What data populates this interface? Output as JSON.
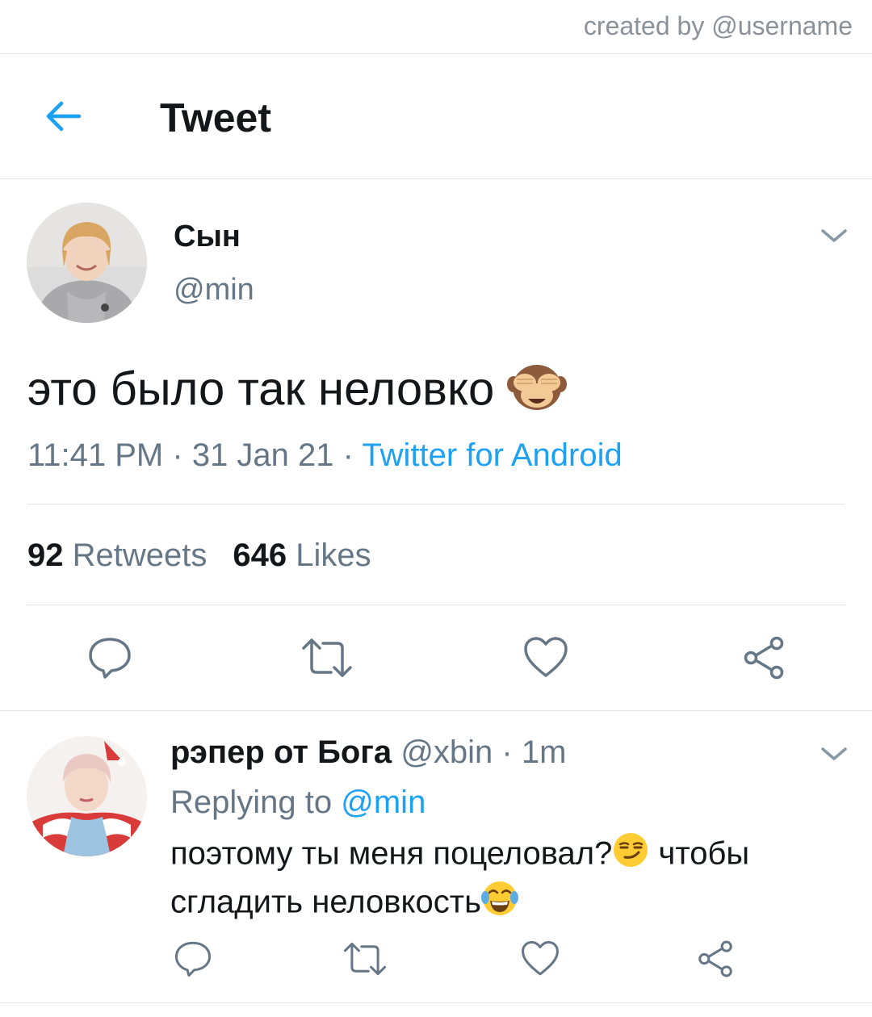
{
  "credit": "created by @username",
  "header": {
    "title": "Tweet"
  },
  "tweet": {
    "author_name": "Сын",
    "author_handle": "@min",
    "text": "это было так неловко",
    "time": "11:41 PM",
    "date": "31 Jan 21",
    "source": "Twitter for Android",
    "separator": "·",
    "retweets_count": "92",
    "retweets_label": "Retweets",
    "likes_count": "646",
    "likes_label": "Likes"
  },
  "reply": {
    "author_name": "рэпер от Бога",
    "author_handle": "@xbin",
    "time": "1m",
    "separator": "·",
    "replying_label": "Replying to",
    "replying_handle": "@min",
    "text_part1": "поэтому ты меня поцеловал?",
    "text_part2": " чтобы сгладить неловкость"
  },
  "icons": {
    "back": "arrow-left-icon",
    "caret": "chevron-down-icon",
    "reply": "reply-icon",
    "retweet": "retweet-icon",
    "like": "heart-icon",
    "share": "share-icon",
    "tweet_emoji": "see-no-evil-monkey-emoji",
    "reply_emoji_1": "smirking-face-emoji",
    "reply_emoji_2": "face-with-tears-of-joy-emoji"
  },
  "colors": {
    "accent": "#1da1f2",
    "secondary_text": "#657786",
    "primary_text": "#14171a",
    "divider": "#e1e4e6"
  }
}
